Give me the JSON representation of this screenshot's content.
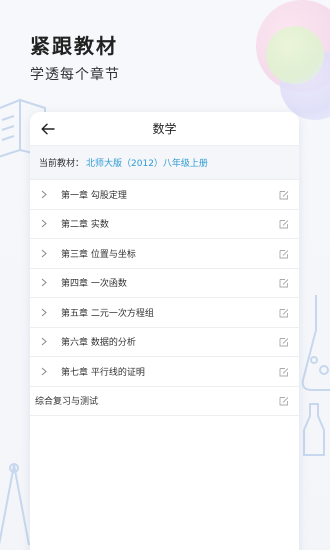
{
  "hero": {
    "title": "紧跟教材",
    "subtitle": "学透每个章节"
  },
  "card": {
    "title": "数学",
    "back_icon": "arrow-left-icon",
    "textbook_label": "当前教材：",
    "textbook_value": "北师大版（2012）八年级上册"
  },
  "chapters": [
    {
      "label": "第一章 勾股定理",
      "icon": "chevron-right-icon",
      "action_icon": "edit-icon"
    },
    {
      "label": "第二章 实数",
      "icon": "chevron-right-icon",
      "action_icon": "edit-icon"
    },
    {
      "label": "第三章 位置与坐标",
      "icon": "chevron-right-icon",
      "action_icon": "edit-icon"
    },
    {
      "label": "第四章 一次函数",
      "icon": "chevron-right-icon",
      "action_icon": "edit-icon"
    },
    {
      "label": "第五章 二元一次方程组",
      "icon": "chevron-right-icon",
      "action_icon": "edit-icon"
    },
    {
      "label": "第六章 数据的分析",
      "icon": "chevron-right-icon",
      "action_icon": "edit-icon"
    },
    {
      "label": "第七章 平行线的证明",
      "icon": "chevron-right-icon",
      "action_icon": "edit-icon"
    }
  ],
  "review": {
    "label": "综合复习与测试",
    "action_icon": "edit-icon"
  },
  "colors": {
    "accent": "#2f9bd6",
    "background": "#f7f8fb",
    "card": "#ffffff",
    "divider": "#eceef2"
  }
}
